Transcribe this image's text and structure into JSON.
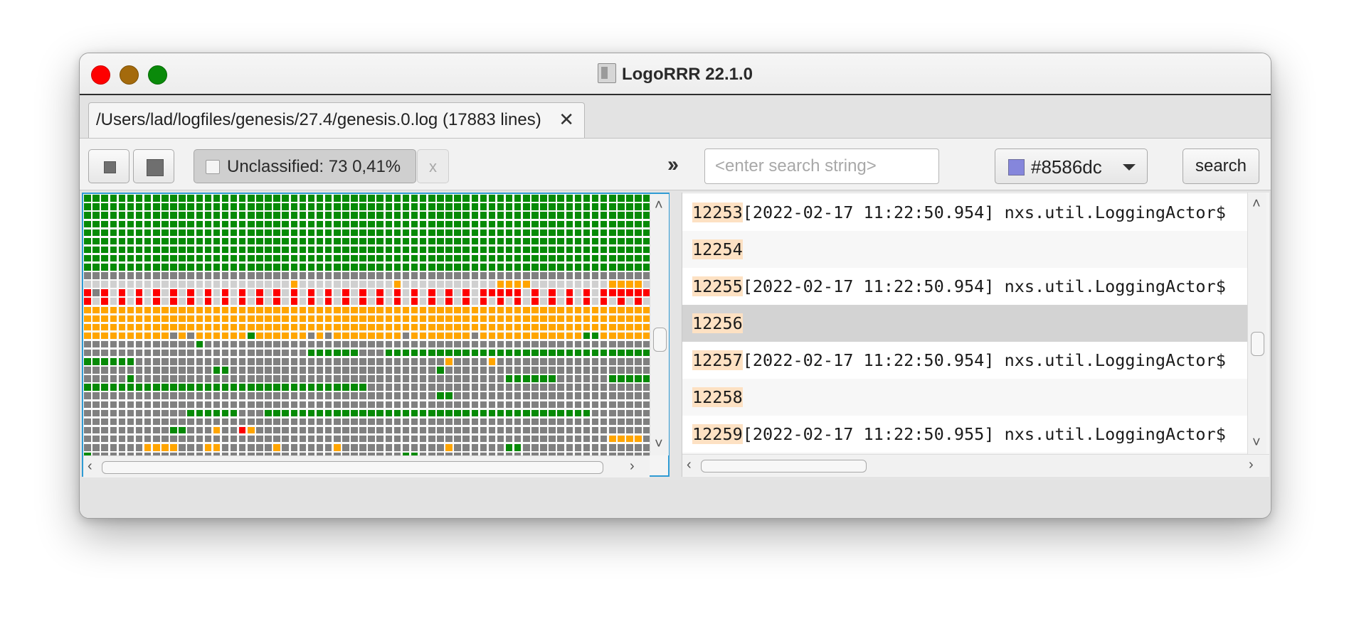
{
  "window": {
    "title": "LogoRRR 22.1.0",
    "controls": [
      "close-button",
      "minimize-button",
      "zoom-button"
    ]
  },
  "tabs": [
    {
      "label": "/Users/lad/logfiles/genesis/27.4/genesis.0.log (17883 lines)",
      "close_label": "✕",
      "active": true
    }
  ],
  "toolbar": {
    "small_square_icon": "square-small-icon",
    "large_square_icon": "square-large-icon",
    "filter_chip_label": "Unclassified: 73 0,41%",
    "filter_chip_checked": false,
    "filter_remove_label": "x",
    "jump_label": "››",
    "search_placeholder": "<enter search string>",
    "search_value": "",
    "color_label": "#8586dc",
    "color_value": "#8586dc",
    "search_button_label": "search"
  },
  "colors": {
    "info": "#068a06",
    "warn": "#ffa500",
    "error": "#fe0000",
    "unclassified": "#808080",
    "light": "#d0d0d0",
    "selection_border": "#2f9bd4",
    "line_number_highlight": "#fde1c3",
    "selected_row": "#d3d3d3"
  },
  "overview_rows": [
    "GGGGGGGGGGGGGGGGGGGGGGGGGGGGGGGGGGGGGGGGGGGGGGGGGGGGGGGGGGGGGGGGGG",
    "GGGGGGGGGGGGGGGGGGGGGGGGGGGGGGGGGGGGGGGGGGGGGGGGGGGGGGGGGGGGGGGGGG",
    "GGGGGGGGGGGGGGGGGGGGGGGGGGGGGGGGGGGGGGGGGGGGGGGGGGGGGGGGGGGGGGGGGG",
    "GGGGGGGGGGGGGGGGGGGGGGGGGGGGGGGGGGGGGGGGGGGGGGGGGGGGGGGGGGGGGGGGGG",
    "GGGGGGGGGGGGGGGGGGGGGGGGGGGGGGGGGGGGGGGGGGGGGGGGGGGGGGGGGGGGGGGGGG",
    "GGGGGGGGGGGGGGGGGGGGGGGGGGGGGGGGGGGGGGGGGGGGGGGGGGGGGGGGGGGGGGGGGG",
    "GGGGGGGGGGGGGGGGGGGGGGGGGGGGGGGGGGGGGGGGGGGGGGGGGGGGGGGGGGGGGGGGGG",
    "GGGGGGGGGGGGGGGGGGGGGGGGGGGGGGGGGGGGGGGGGGGGGGGGGGGGGGGGGGGGGGGGGG",
    "GGGGGGGGGGGGGGGGGGGGGGGGGGGGGGGGGGGGGGGGGGGGGGGGGGGGGGGGGGGGGGGGGG",
    "UUUUUUUUUUUUUUUUUUUUUUUUUUUUUUUUUUUUUUUUUUUUUUUUUUUUUUUUUUUUUUUUUU",
    "LLLLLLLLLLLLLLLLLLLLLLLLOLLLLLLLLLLLOLLLLLLLLLLLOOOOLLLLLLLLLOOOOL",
    "RURLRLRLRLRLRLRLRLRLRLRLRLRLRLRLRLRLRLRLRLRLRLRRRRRLRLRLRLRLRRRRRR",
    "RLRLRLRLRLRLRLRLRLRLRLRLRLRLRLRLRLRLRLRLRLRLRLRLRLRLRLRLRLRLRLRLRL",
    "OOOOOOOOOOOOOOOOOOOOOOOOOOOOOOOOOOOOOOOOOOOOOOOOOOOOOOOOOOOOOOOOOO",
    "OOOOOOOOOOOOOOOOOOOOOOOOOOOOOOOOOOOOOOOOOOOOOOOOOOOOOOOOOOOOOOOOOO",
    "OOOOOOOOOOOOOOOOOOOOOOOOOOOOOOOOOOOOOOOOOOOOOOOOOOOOOOOOOOOOOOOOOO",
    "OOOOOOOOOOUOUOOOOOOGOOOOOOUOUOOOOOOOOUOOOOOOOUOOOOOOOOOOOOGGOOOOOO",
    "UUUUUUUUUUUUUGUUUUUUUUUUUUUUUUUUUUUUUUUUUUUUUUUUUUUUUUUUUUUUUUUUUU",
    "UUUUUUUUUUUUUUUUUUUUUUUUUUGGGGGGUUUGGGGGGGGGGGGGGGGGGGGGGGGGGGGGGG",
    "GGGGGGUUUUUUUUUUUUUUUUUUUUUUUUUUUUUUUUUUUUOUUUUOUUUUUUUUUUUUUUUUUU",
    "UUUUUUUUUUUUUUUGGUUUUUUUUUUUUUUUUUUUUUUUUGUUUUUUUUUUUUUUUUUUUUUUUU",
    "UUUUUGUUUUUUUUUUUUUUUUUUUUUUUUUUUUUUUUUUUUUUUUUUUGGGGGGUUUUUUGGGGG",
    "GGGGGGGGGGGGGGGGGGGGGGGGGGGGGGGGGUUUUUUUUUUUUUUUUUUUUUUUUUUUUUUUUU",
    "UUUUUUUUUUUUUUUUUUUUUUUUUUUUUUUUUUUUUUUUUGGUUUUUUUUUUUUUUUUUUUUUUU",
    "UUUUUUUUUUUUUUUUUUUUUUUUUUUUUUUUUUUUUUUUUUUUUUUUUUUUUUUUUUUUUUUUUU",
    "UUUUUUUUUUUUGGGGGGUUUGGGGGGGGGGGGGGGGGGGGGGGGGGGGGGGGGGGGGGUUUUUUU",
    "UUUUUUUUUUUUUUUUUUUUUUUUUUUUUUUUUUUUUUUUUUUUUUUUUUUUUUUUUUUUUUUUUU",
    "UUUUUUUUUUGGUUUOUUROUUUUUUUUUUUUUUUUUUUUUUUUUUUUUUUUUUUUUUUUUUUUUU",
    "UUUUUUUUUUUUUUUUUUUUUUUUUUUUUUUUUUUUUUUUUUUUUUUUUUUUUUUUUUUUUOOOOU",
    "UUUUUUUOOOOUUUOOUUUUUUOUUUUUUOUUUUUUUUUUUUOUUUUUUGGUUUUUUUUUUUUUUU",
    "GUUUUUUUUUUUUUUUUUUUUUUUUUUUUUUUUUUUUGGUUUUUUUUUUUUUUUUUUUUUUUUUUU"
  ],
  "log_lines": [
    {
      "number": "12253",
      "text": "[2022-02-17 11:22:50.954] nxs.util.LoggingActor$",
      "selected": false
    },
    {
      "number": "12254",
      "text": "",
      "selected": false
    },
    {
      "number": "12255",
      "text": "[2022-02-17 11:22:50.954] nxs.util.LoggingActor$",
      "selected": false
    },
    {
      "number": "12256",
      "text": "",
      "selected": true
    },
    {
      "number": "12257",
      "text": "[2022-02-17 11:22:50.954] nxs.util.LoggingActor$",
      "selected": false
    },
    {
      "number": "12258",
      "text": "",
      "selected": false
    },
    {
      "number": "12259",
      "text": "[2022-02-17 11:22:50.955] nxs.util.LoggingActor$",
      "selected": false
    }
  ],
  "scroll": {
    "overview_vertical_position": 0.57,
    "overview_horizontal_fraction": 0.95,
    "log_vertical_position": 0.6,
    "log_horizontal_fraction": 0.3
  },
  "scroll_arrows": {
    "up": "˄",
    "down": "˅",
    "left": "‹",
    "right": "›"
  }
}
